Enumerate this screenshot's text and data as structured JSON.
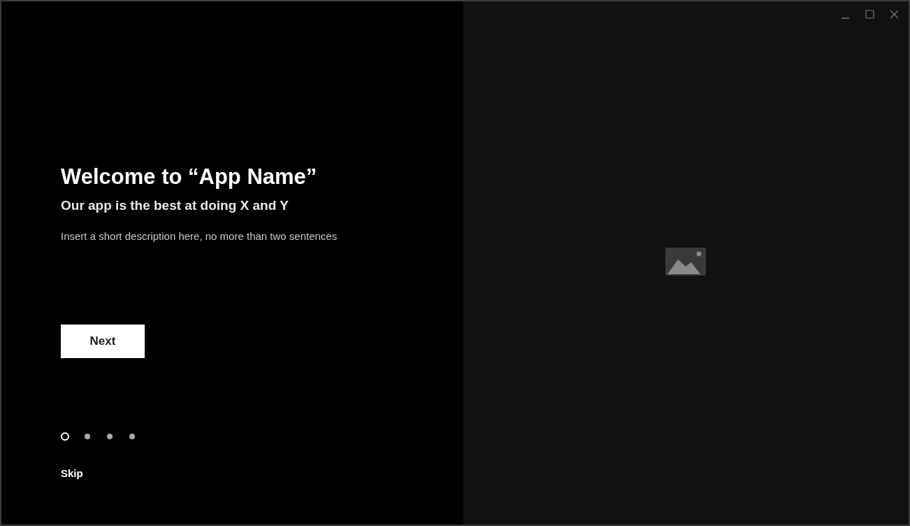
{
  "title": "Welcome to “App Name”",
  "subtitle": "Our app is the best at doing X and Y",
  "description": "Insert a short description here, no more than two sentences",
  "next_button": "Next",
  "pages": [
    {
      "selected": true
    },
    {
      "selected": false
    },
    {
      "selected": false
    },
    {
      "selected": false
    }
  ],
  "skip": "Skip"
}
